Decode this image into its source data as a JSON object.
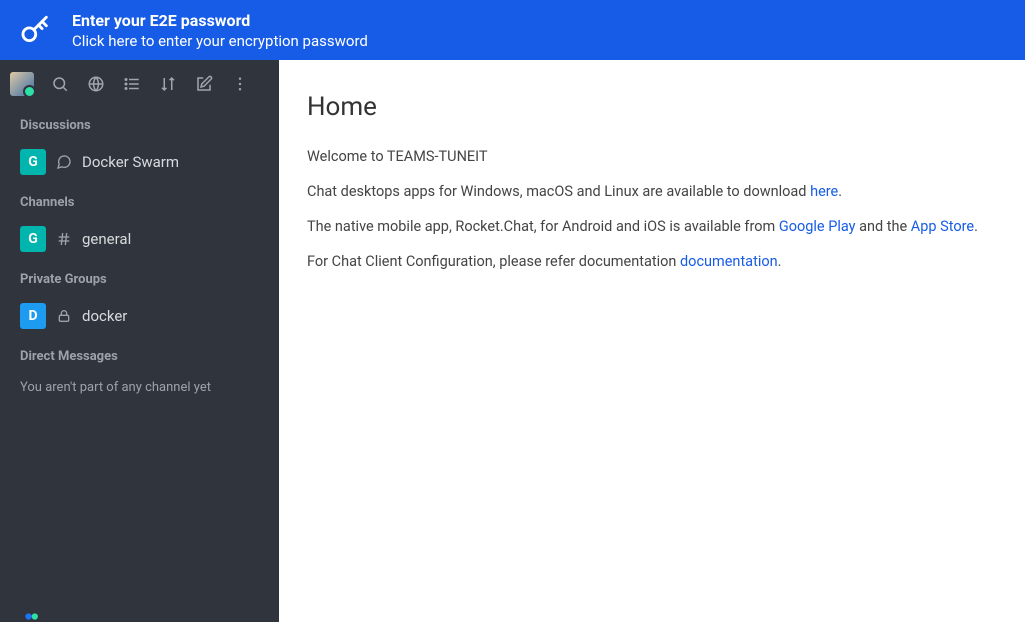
{
  "banner": {
    "title": "Enter your E2E password",
    "subtitle": "Click here to enter your encryption password"
  },
  "sidebar": {
    "sections": [
      {
        "title": "Discussions",
        "items": [
          {
            "chip": "G",
            "chipColor": "g",
            "icon": "discussion",
            "label": "Docker Swarm"
          }
        ]
      },
      {
        "title": "Channels",
        "items": [
          {
            "chip": "G",
            "chipColor": "g",
            "icon": "hash",
            "label": "general"
          }
        ]
      },
      {
        "title": "Private Groups",
        "items": [
          {
            "chip": "D",
            "chipColor": "d",
            "icon": "lock",
            "label": "docker"
          }
        ]
      },
      {
        "title": "Direct Messages",
        "empty": "You aren't part of any channel yet"
      }
    ]
  },
  "home": {
    "title": "Home",
    "welcome": "Welcome to TEAMS-TUNEIT",
    "p1_a": "Chat desktops apps for Windows, macOS and Linux are available to download ",
    "p1_link": "here",
    "p1_c": ".",
    "p2_a": "The native mobile app, Rocket.Chat, for Android and iOS is available from ",
    "p2_link1": "Google Play",
    "p2_b": " and the ",
    "p2_link2": "App Store",
    "p2_c": ".",
    "p3_a": "For Chat Client Configuration, please refer documentation ",
    "p3_link": "documentation",
    "p3_c": "."
  }
}
